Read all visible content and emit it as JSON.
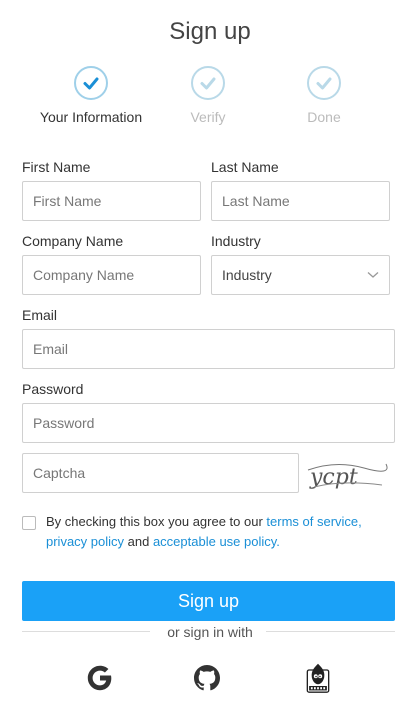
{
  "page_title": "Sign up",
  "steps": [
    {
      "label": "Your Information",
      "state": "active"
    },
    {
      "label": "Verify",
      "state": "pending"
    },
    {
      "label": "Done",
      "state": "pending"
    }
  ],
  "form": {
    "first_name": {
      "label": "First Name",
      "placeholder": "First Name"
    },
    "last_name": {
      "label": "Last Name",
      "placeholder": "Last Name"
    },
    "company": {
      "label": "Company Name",
      "placeholder": "Company Name"
    },
    "industry": {
      "label": "Industry",
      "selected": "Industry"
    },
    "email": {
      "label": "Email",
      "placeholder": "Email"
    },
    "password": {
      "label": "Password",
      "placeholder": "Password"
    },
    "captcha": {
      "placeholder": "Captcha",
      "image_text": "ycpt"
    }
  },
  "agreement": {
    "prefix": "By checking this box you agree to our ",
    "terms": "terms of service",
    "sep1": ",",
    "privacy": "privacy policy",
    "and": " and ",
    "acceptable": "acceptable use policy",
    "suffix": "."
  },
  "submit_label": "Sign up",
  "alt_signin_label": "or sign in with",
  "social": [
    "google-icon",
    "github-icon",
    "cocos-icon"
  ],
  "colors": {
    "accent": "#1aa1f7",
    "link": "#1a8fd6",
    "step_check": "#1a8fd6",
    "step_check_pending": "#b9d9e8"
  }
}
